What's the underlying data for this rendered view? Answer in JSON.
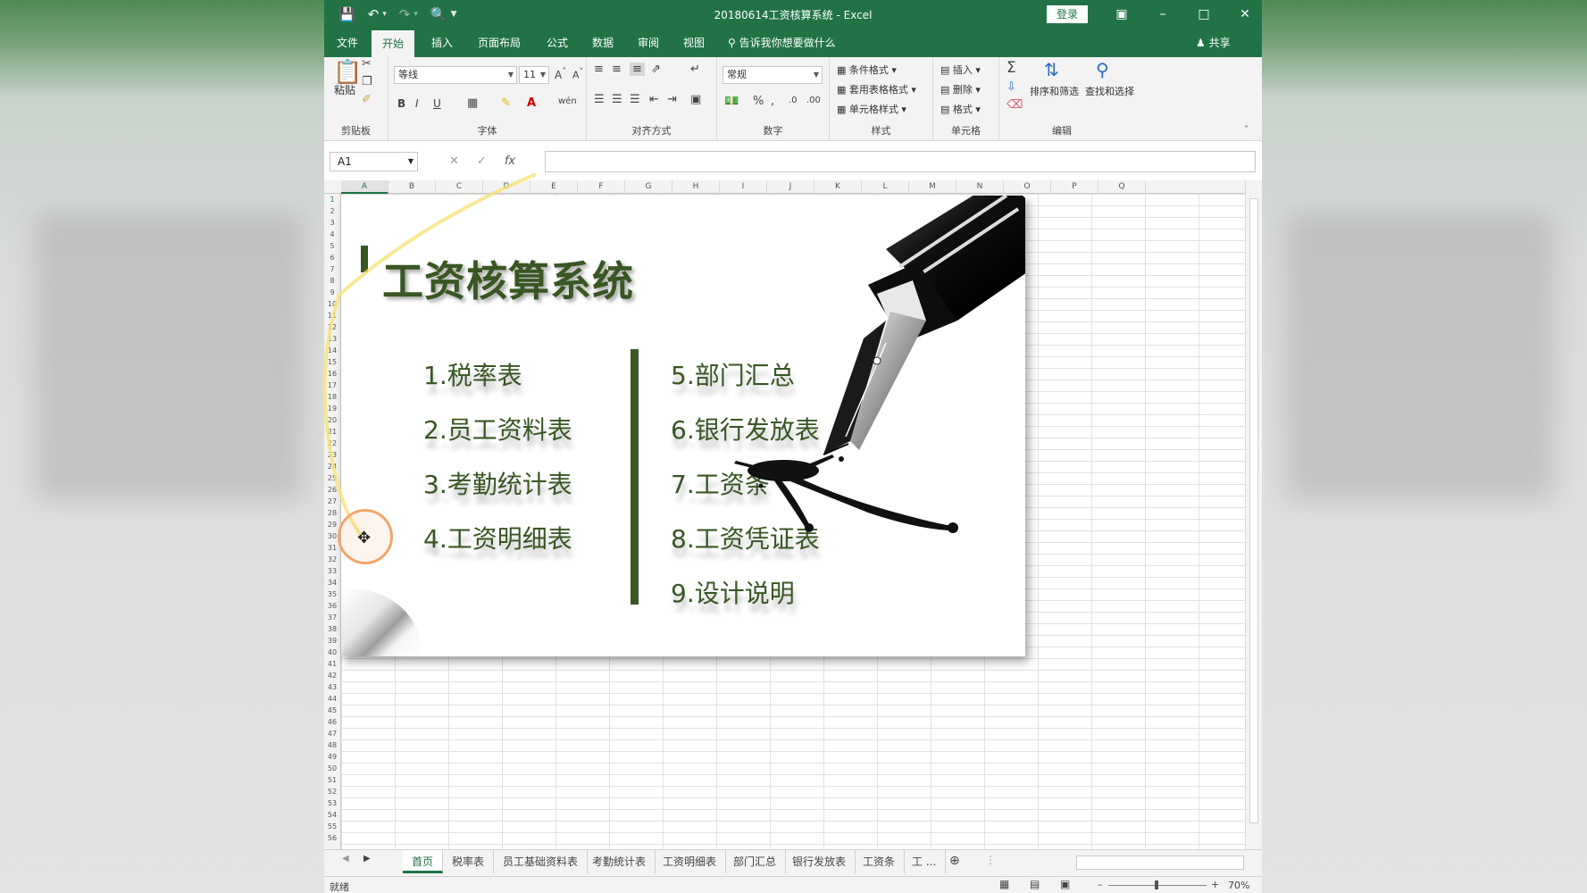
{
  "window": {
    "title": "20180614工资核算系统  -  Excel",
    "login_label": "登录",
    "share_label": "共享"
  },
  "ribbon_tabs": [
    "文件",
    "开始",
    "插入",
    "页面布局",
    "公式",
    "数据",
    "审阅",
    "视图"
  ],
  "active_tab": "开始",
  "tell_me": "告诉我你想要做什么",
  "ribbon": {
    "clipboard": {
      "label": "剪贴板",
      "paste": "粘贴"
    },
    "font": {
      "label": "字体",
      "font_name": "等线",
      "font_size": "11"
    },
    "alignment": {
      "label": "对齐方式"
    },
    "number": {
      "label": "数字",
      "format": "常规"
    },
    "styles": {
      "label": "样式",
      "conditional": "条件格式",
      "table": "套用表格格式",
      "cell": "单元格样式"
    },
    "cells": {
      "label": "单元格",
      "insert": "插入",
      "delete": "删除",
      "format": "格式"
    },
    "editing": {
      "label": "编辑",
      "sort": "排序和筛选",
      "find": "查找和选择"
    }
  },
  "formula_bar": {
    "name_box": "A1",
    "fx": "fx",
    "value": ""
  },
  "columns": [
    "A",
    "B",
    "C",
    "D",
    "E",
    "F",
    "G",
    "H",
    "I",
    "J",
    "K",
    "L",
    "M",
    "N",
    "O",
    "P",
    "Q"
  ],
  "row_count": 56,
  "card": {
    "title": "工资核算系统",
    "left_items": [
      "1.税率表",
      "2.员工资料表",
      "3.考勤统计表",
      "4.工资明细表"
    ],
    "right_items": [
      "5.部门汇总",
      "6.银行发放表",
      "7.工资条",
      "8.工资凭证表",
      "9.设计说明"
    ]
  },
  "sheet_tabs": [
    "首页",
    "税率表",
    "员工基础资料表",
    "考勤统计表",
    "工资明细表",
    "部门汇总",
    "银行发放表",
    "工资条",
    "工 ..."
  ],
  "active_sheet": "首页",
  "status": {
    "text": "就绪",
    "zoom": "70%"
  },
  "colors": {
    "excel_green": "#217346",
    "title_green": "#385723",
    "cursor_ring": "#f2a66b"
  }
}
